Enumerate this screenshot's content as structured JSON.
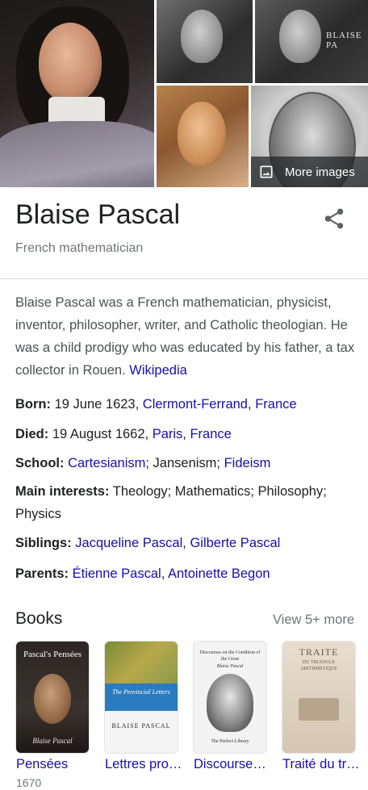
{
  "images": {
    "tile_caption": "BLAISE PA",
    "more_label": "More images"
  },
  "entity": {
    "name": "Blaise Pascal",
    "subtitle": "French mathematician"
  },
  "description": {
    "text": "Blaise Pascal was a French mathematician, physicist, inventor, philosopher, writer, and Catholic theologian. He was a child prodigy who was educated by his father, a tax collector in Rouen.",
    "source": "Wikipedia"
  },
  "facts": {
    "born": {
      "label": "Born:",
      "text": "19 June 1623,",
      "link1": "Clermont-Ferrand",
      "sep": ",",
      "link2": "France"
    },
    "died": {
      "label": "Died:",
      "text": "19 August 1662,",
      "link1": "Paris, France"
    },
    "school": {
      "label": "School:",
      "link1": "Cartesianism",
      "text": "; Jansenism;",
      "link2": "Fideism"
    },
    "interests": {
      "label": "Main interests:",
      "text": "Theology; Mathematics; Philosophy; Physics"
    },
    "siblings": {
      "label": "Siblings:",
      "link1": "Jacqueline Pascal",
      "sep": ",",
      "link2": "Gilberte Pascal"
    },
    "parents": {
      "label": "Parents:",
      "link1": "Étienne Pascal",
      "sep": ",",
      "link2": "Antoinette Begon"
    }
  },
  "books": {
    "heading": "Books",
    "view_more": "View 5+ more",
    "items": [
      {
        "title": "Pensées",
        "year": "1670",
        "cover_title": "Pascal's Pensées",
        "cover_author": "Blaise Pascal"
      },
      {
        "title": "Lettres provinciales",
        "cover_title": "The Provincial Letters",
        "cover_author": "BLAISE PASCAL"
      },
      {
        "title": "Discourses on the",
        "cover_title": "Discourses on the Condition of the Great",
        "cover_author": "Blaise Pascal",
        "cover_publisher": "The Perfect Library"
      },
      {
        "title": "Traité du triangle",
        "cover_title": "TRAITE",
        "cover_sub": "DU TRIANGLE ARITHMETIQUE"
      }
    ]
  },
  "colors": {
    "link": "#1a0dab",
    "secondary": "#70757a",
    "text": "#202124"
  }
}
